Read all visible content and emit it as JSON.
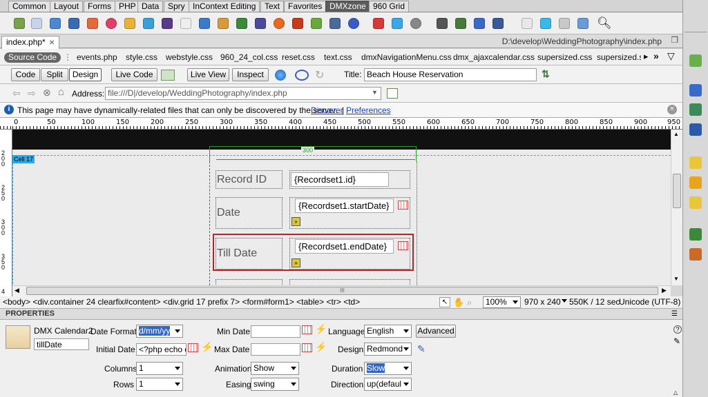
{
  "insert_tabs": [
    "Common",
    "Layout",
    "Forms",
    "PHP",
    "Data",
    "Spry",
    "InContext Editing",
    "Text",
    "Favorites",
    "DMXzone",
    "960 Grid"
  ],
  "active_insert_tab": "DMXzone",
  "doc_tab": {
    "name": "index.php*",
    "close": "×"
  },
  "file_path": "D:\\develop\\WeddingPhotography\\index.php",
  "related_files": {
    "source_label": "Source Code",
    "files": [
      "events.php",
      "style.css",
      "webstyle.css",
      "960_24_col.css",
      "reset.css",
      "text.css",
      "dmxNavigationMenu.css",
      "dmx_ajaxcalendar.css",
      "supersized.css",
      "supersized.s"
    ]
  },
  "view_toolbar": {
    "code": "Code",
    "split": "Split",
    "design": "Design",
    "live_code": "Live Code",
    "live_view": "Live View",
    "inspect": "Inspect",
    "title_label": "Title:",
    "title_value": "Beach House Reservation"
  },
  "address": {
    "label": "Address:",
    "value": "file:///D|/develop/WeddingPhotography/index.php"
  },
  "infobar": {
    "message": "This page may have dynamically-related files that can only be discovered by the server.",
    "discover": "Discover",
    "separator": "|",
    "preferences": "Preferences"
  },
  "ruler_labels": [
    "0",
    "50",
    "100",
    "150",
    "200",
    "250",
    "300",
    "350",
    "400",
    "450",
    "500",
    "550",
    "600",
    "650",
    "700",
    "750",
    "800",
    "850",
    "900",
    "950"
  ],
  "vruler_labels": [
    "2 0 0",
    "2 5 0",
    "3 0 0",
    "3 5 0",
    "4"
  ],
  "canvas": {
    "cell_badge": "Cell 17",
    "width_guide": "300",
    "form": [
      {
        "label": "Record ID",
        "value": "{Recordset1.id}"
      },
      {
        "label": "Date",
        "value": "{Recordset1.startDate}"
      },
      {
        "label": "Till Date",
        "value": "{Recordset1.endDate}"
      }
    ],
    "scroll_thumb": "III"
  },
  "status": {
    "tag_path": "<body> <div.container 24 clearfix#content> <div.grid 17 prefix 7> <form#form1> <table> <tr> <td>",
    "zoom": "100%",
    "dimensions": "970 x 240",
    "size_time": "550K / 12 sec",
    "encoding": "Unicode (UTF-8)"
  },
  "properties": {
    "header": "PROPERTIES",
    "widget_name": "DMX Calendar2",
    "widget_id": "tillDate",
    "date_format_label": "Date Format",
    "date_format": "d/mm/yy",
    "initial_date_label": "Initial Date",
    "initial_date": "<?php echo d",
    "min_date_label": "Min Date",
    "min_date": "",
    "max_date_label": "Max Date",
    "max_date": "",
    "language_label": "Language",
    "language": "English",
    "advanced_button": "Advanced",
    "design_label": "Design",
    "design": "Redmond",
    "columns_label": "Columns",
    "columns": "1",
    "rows_label": "Rows",
    "rows": "1",
    "animation_label": "Animation",
    "animation": "Show",
    "easing_label": "Easing",
    "easing": "swing",
    "duration_label": "Duration",
    "duration": "Slow",
    "direction_label": "Direction",
    "direction": "up(defaul"
  },
  "icons": [
    "refresh-icon",
    "globe-icon",
    "file-icon",
    "calendar-icon",
    "search-icon",
    "help-icon",
    "close-icon"
  ]
}
